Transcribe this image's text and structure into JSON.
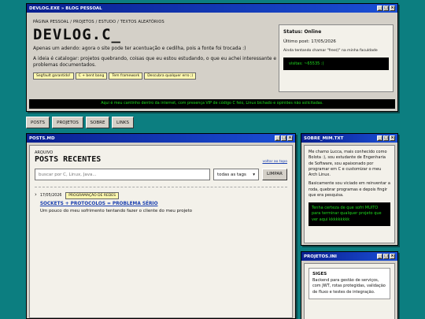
{
  "top_window": {
    "title": "DEVLOG.EXE » BLOG PESSOAL",
    "tagline": "PÁGINA PESSOAL / PROJETOS / ESTUDO / TEXTOS ALEATÓRIOS",
    "logo": "DEVLOG.C_",
    "intro1": "Apenas um adendo: agora o site pode ter acentuação e cedilha, pois a fonte foi trocada :)",
    "intro2": "A ideia é catalogar: projetos quebrando, coisas que eu estou estudando, o que eu achei interessante e problemas documentados.",
    "chips": [
      "Segfault garantido!",
      "C + bent bang",
      "Tem framework",
      "Descubra qualquer erro ;)"
    ],
    "status_label": "Status: Online",
    "last_post": "Último post: 17/05/2026",
    "status_note": "Ainda tentando chamar \"free()\" na minha faculdade",
    "visits": "visitas: ~65535 :(",
    "marquee": "Aqui é meu cantinho dentro da internet, com presença VIP de código C feio, Linux bichado e opiniões não solicitadas."
  },
  "nav": [
    "POSTS",
    "PROJETOS",
    "SOBRE",
    "LINKS"
  ],
  "posts_window": {
    "title": "POSTS.MD",
    "section": "ARQUIVO",
    "heading": "POSTS RECENTES",
    "back_top": "voltar ao topo",
    "search_placeholder": "buscar por C, Linux, Java...",
    "tag_select": "todas as tags",
    "clear_button": "LIMPAR",
    "post": {
      "date": "17/05/2026",
      "tag": "PROGRAMAÇÃO DE REDES",
      "title": "SOCKETS + PROTOCOLOS = PROBLEMA SÉRIO",
      "summary": "Um pouco do meu sofrimento tentando fazer o cliente do meu projeto"
    }
  },
  "about_window": {
    "title": "SOBRE_MIM.TXT",
    "p1": "Me chamo Lucca, mais conhecido como Bolota :), sou estudante de Engenharia de Software, sou apaixonado por programar em C e customizar o meu Arch Linux.",
    "p2": "Basicamente sou viciado em reinventar a roda, quebrar programas e depois fingir que era pesquisa.",
    "green": "Tenha certeza de que sofri MUITO para terminar qualquer projeto que ver aqui kkkkkkkkk"
  },
  "projects_window": {
    "title": "PROJETOS.INI",
    "name": "SIGES",
    "desc": "Backend para gestão de serviços, com JWT, rotas protegidas, validação de fluxo e testes de integração."
  }
}
